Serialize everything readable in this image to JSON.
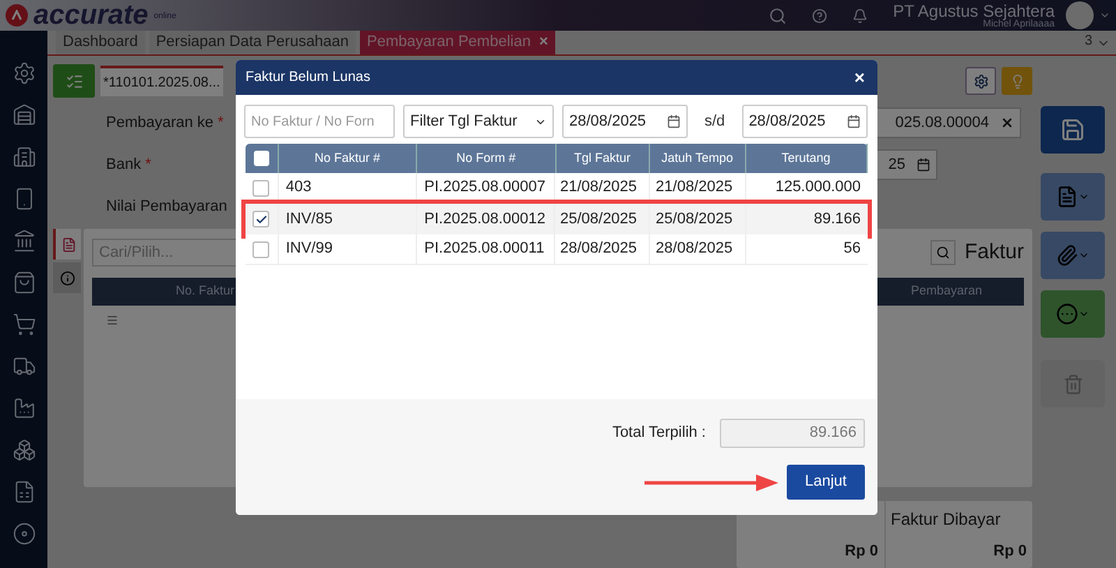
{
  "header": {
    "logo": "accurate",
    "logo_sub": "online",
    "company": "PT Agustus Sejahtera",
    "user": "Michel Aprilaaaa"
  },
  "tabs": [
    {
      "label": "Dashboard",
      "selected": false
    },
    {
      "label": "Persiapan Data Perusahaan",
      "selected": false
    },
    {
      "label": "Pembayaran Pembelian",
      "selected": true,
      "close": "×"
    }
  ],
  "tab_count": "3",
  "form": {
    "number": "*110101.2025.08...",
    "fields": [
      {
        "label": "Pembayaran ke",
        "required_mark": "*",
        "value": "025.08.00004"
      },
      {
        "label": "Bank",
        "required_mark": "*",
        "value": "25"
      },
      {
        "label": "Nilai Pembayaran"
      }
    ],
    "search_placeholder": "Cari/Pilih...",
    "detail_title": "Faktur",
    "columns": [
      "No. Faktur",
      "Pembayaran"
    ],
    "summary": [
      {
        "label": "Faktur Dibayar",
        "value": "Rp 0"
      }
    ],
    "summary_left_value": "Rp 0"
  },
  "dialog": {
    "title": "Faktur Belum Lunas",
    "close": "×",
    "search": {
      "placeholder": "No Faktur / No Forn"
    },
    "filter": "Filter Tgl Faktur",
    "date_from": "28/08/2025",
    "range_sep": "s/d",
    "date_to": "28/08/2025",
    "all_selected": false,
    "columns": [
      "No Faktur #",
      "No Form #",
      "Tgl Faktur",
      "Jatuh Tempo",
      "Terutang"
    ],
    "rows": [
      {
        "no_faktur": "403",
        "no_form": "PI.2025.08.00007",
        "tgl_faktur": "21/08/2025",
        "jatuh_tempo": "21/08/2025",
        "terutang": "125.000.000",
        "selected": false,
        "highlighted": false
      },
      {
        "no_faktur": "INV/85",
        "no_form": "PI.2025.08.00012",
        "tgl_faktur": "25/08/2025",
        "jatuh_tempo": "25/08/2025",
        "terutang": "89.166",
        "selected": true,
        "highlighted": true
      },
      {
        "no_faktur": "INV/99",
        "no_form": "PI.2025.08.00011",
        "tgl_faktur": "28/08/2025",
        "jatuh_tempo": "28/08/2025",
        "terutang": "56",
        "selected": false,
        "highlighted": false
      }
    ],
    "total_label": "Total Terpilih :",
    "total_value": "89.166",
    "submit": "Lanjut",
    "arrow_to_submit": true
  }
}
